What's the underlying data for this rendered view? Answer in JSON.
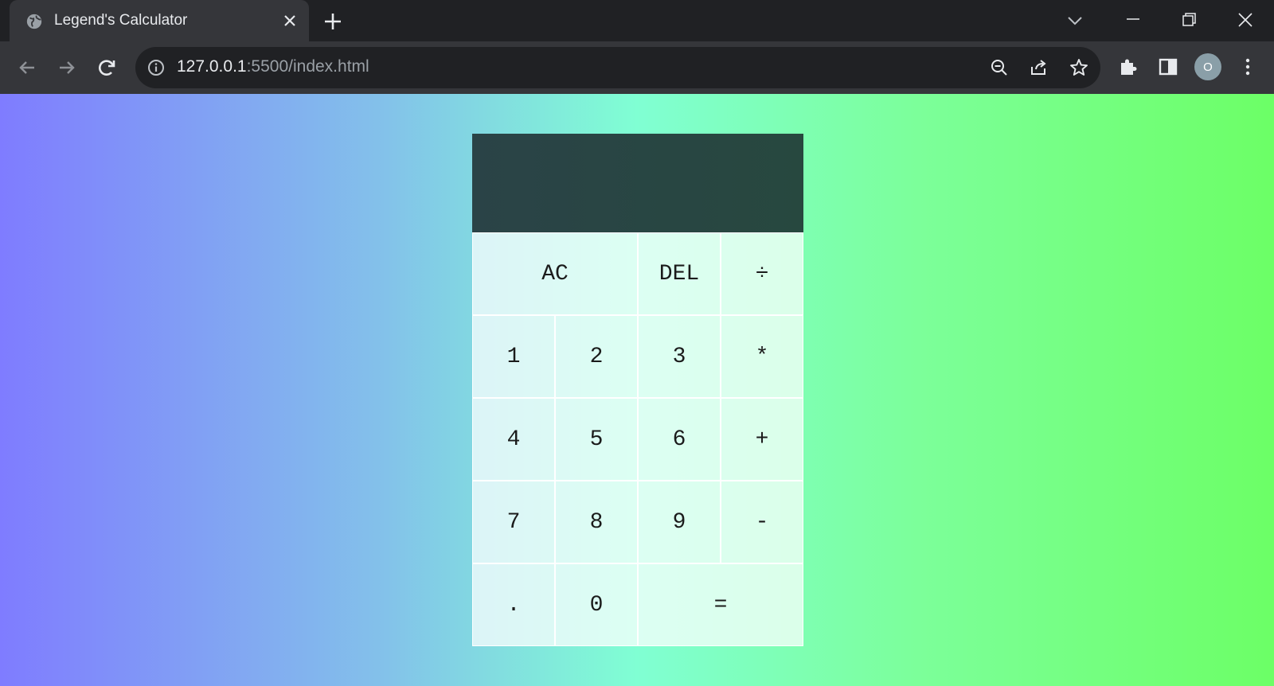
{
  "browser": {
    "tab": {
      "title": "Legend's Calculator"
    },
    "omnibox": {
      "host": "127.0.0.1",
      "rest": ":5500/index.html"
    },
    "profile": {
      "initial": "O"
    }
  },
  "calculator": {
    "display": {
      "previous": "",
      "current": ""
    },
    "rows": [
      [
        {
          "label": "AC",
          "name": "all-clear-button",
          "span": 2
        },
        {
          "label": "DEL",
          "name": "delete-button"
        },
        {
          "label": "÷",
          "name": "divide-button"
        }
      ],
      [
        {
          "label": "1",
          "name": "digit-1-button"
        },
        {
          "label": "2",
          "name": "digit-2-button"
        },
        {
          "label": "3",
          "name": "digit-3-button"
        },
        {
          "label": "*",
          "name": "multiply-button"
        }
      ],
      [
        {
          "label": "4",
          "name": "digit-4-button"
        },
        {
          "label": "5",
          "name": "digit-5-button"
        },
        {
          "label": "6",
          "name": "digit-6-button"
        },
        {
          "label": "+",
          "name": "add-button"
        }
      ],
      [
        {
          "label": "7",
          "name": "digit-7-button"
        },
        {
          "label": "8",
          "name": "digit-8-button"
        },
        {
          "label": "9",
          "name": "digit-9-button"
        },
        {
          "label": "-",
          "name": "subtract-button"
        }
      ],
      [
        {
          "label": ".",
          "name": "decimal-button"
        },
        {
          "label": "0",
          "name": "digit-0-button"
        },
        {
          "label": "=",
          "name": "equals-button",
          "span": 2
        }
      ]
    ]
  }
}
